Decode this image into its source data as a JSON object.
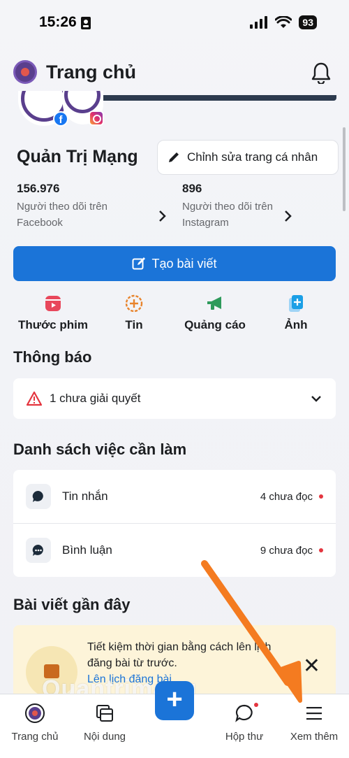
{
  "status_bar": {
    "time": "15:26",
    "battery": "93"
  },
  "header": {
    "title": "Trang chủ"
  },
  "profile": {
    "name": "Quản Trị Mạng",
    "edit_label": "Chỉnh sửa trang cá nhân",
    "stats": [
      {
        "value": "156.976",
        "label": "Người theo dõi trên Facebook"
      },
      {
        "value": "896",
        "label": "Người theo dõi trên Instagram"
      }
    ]
  },
  "create_post": {
    "label": "Tạo bài viết"
  },
  "quick_actions": [
    {
      "label": "Thước phim",
      "icon": "reels-icon",
      "color": "#e8475b"
    },
    {
      "label": "Tin",
      "icon": "story-plus-icon",
      "color": "#e8832b"
    },
    {
      "label": "Quảng cáo",
      "icon": "megaphone-icon",
      "color": "#2e9a5b"
    },
    {
      "label": "Ảnh",
      "icon": "photo-plus-icon",
      "color": "#1b9fe6"
    }
  ],
  "notifications": {
    "title": "Thông báo",
    "alert_text": "1 chưa giải quyết"
  },
  "todo": {
    "title": "Danh sách việc cần làm",
    "items": [
      {
        "label": "Tin nhắn",
        "count": "4 chưa đọc",
        "icon": "message-bubble-icon"
      },
      {
        "label": "Bình luận",
        "count": "9 chưa đọc",
        "icon": "comment-bubble-icon"
      }
    ]
  },
  "recent_posts": {
    "title": "Bài viết gần đây",
    "tip_text": "Tiết kiệm thời gian bằng cách lên lịch đăng bài từ trước.",
    "tip_link": "Lên lịch đăng bài"
  },
  "watermark": "Quantrimang",
  "bottom_nav": [
    {
      "label": "Trang chủ",
      "icon": "home-avatar-icon"
    },
    {
      "label": "Nội dung",
      "icon": "content-icon"
    },
    {
      "label": "Hộp thư",
      "icon": "inbox-icon"
    },
    {
      "label": "Xem thêm",
      "icon": "menu-icon"
    }
  ],
  "colors": {
    "primary": "#1b74d8",
    "alert_red": "#e4353f",
    "annotation_arrow": "#f47b20"
  }
}
